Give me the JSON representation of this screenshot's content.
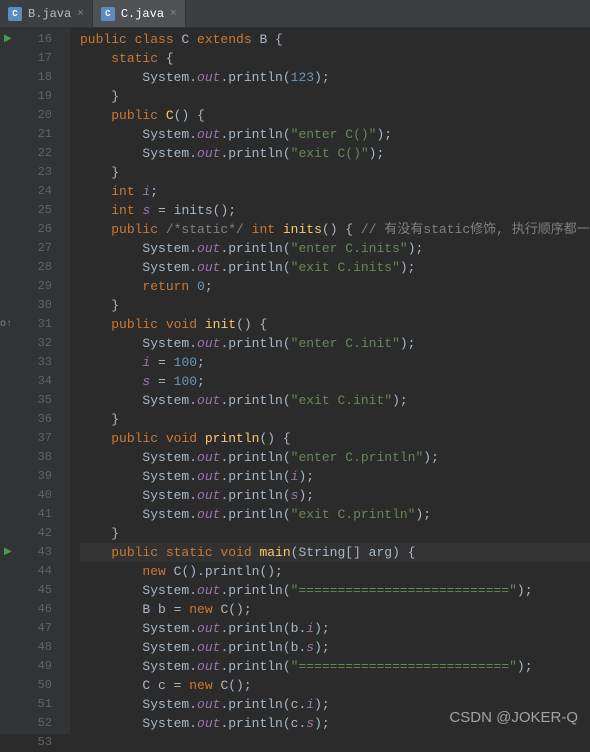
{
  "tabs": [
    {
      "label": "B.java",
      "active": false
    },
    {
      "label": "C.java",
      "active": true
    }
  ],
  "startLine": 16,
  "currentLine": 43,
  "runMarkers": [
    16,
    43
  ],
  "overrideMarkers": [
    31
  ],
  "code": [
    [
      [
        "kw",
        "public class "
      ],
      [
        "ident",
        "C "
      ],
      [
        "kw",
        "extends "
      ],
      [
        "ident",
        "B {"
      ]
    ],
    [
      [
        "ident",
        "    "
      ],
      [
        "kw",
        "static "
      ],
      [
        "ident",
        "{"
      ]
    ],
    [
      [
        "ident",
        "        System."
      ],
      [
        "field",
        "out"
      ],
      [
        "ident",
        ".println("
      ],
      [
        "num",
        "123"
      ],
      [
        "ident",
        ");"
      ]
    ],
    [
      [
        "ident",
        "    }"
      ]
    ],
    [
      [
        "ident",
        "    "
      ],
      [
        "kw",
        "public "
      ],
      [
        "method",
        "C"
      ],
      [
        "ident",
        "() {"
      ]
    ],
    [
      [
        "ident",
        "        System."
      ],
      [
        "field",
        "out"
      ],
      [
        "ident",
        ".println("
      ],
      [
        "str",
        "\"enter C()\""
      ],
      [
        "ident",
        ");"
      ]
    ],
    [
      [
        "ident",
        "        System."
      ],
      [
        "field",
        "out"
      ],
      [
        "ident",
        ".println("
      ],
      [
        "str",
        "\"exit C()\""
      ],
      [
        "ident",
        ");"
      ]
    ],
    [
      [
        "ident",
        "    }"
      ]
    ],
    [
      [
        "ident",
        "    "
      ],
      [
        "kw",
        "int "
      ],
      [
        "field",
        "i"
      ],
      [
        "ident",
        ";"
      ]
    ],
    [
      [
        "ident",
        "    "
      ],
      [
        "kw",
        "int "
      ],
      [
        "field",
        "s"
      ],
      [
        "ident",
        " = inits();"
      ]
    ],
    [
      [
        "ident",
        "    "
      ],
      [
        "kw",
        "public "
      ],
      [
        "comment",
        "/*static*/ "
      ],
      [
        "kw",
        "int "
      ],
      [
        "method",
        "inits"
      ],
      [
        "ident",
        "() { "
      ],
      [
        "comment",
        "// 有没有static修饰, 执行顺序都一样"
      ]
    ],
    [
      [
        "ident",
        "        System."
      ],
      [
        "field",
        "out"
      ],
      [
        "ident",
        ".println("
      ],
      [
        "str",
        "\"enter C.inits\""
      ],
      [
        "ident",
        ");"
      ]
    ],
    [
      [
        "ident",
        "        System."
      ],
      [
        "field",
        "out"
      ],
      [
        "ident",
        ".println("
      ],
      [
        "str",
        "\"exit C.inits\""
      ],
      [
        "ident",
        ");"
      ]
    ],
    [
      [
        "ident",
        "        "
      ],
      [
        "kw",
        "return "
      ],
      [
        "num",
        "0"
      ],
      [
        "ident",
        ";"
      ]
    ],
    [
      [
        "ident",
        "    }"
      ]
    ],
    [
      [
        "ident",
        "    "
      ],
      [
        "kw",
        "public void "
      ],
      [
        "method",
        "init"
      ],
      [
        "ident",
        "() {"
      ]
    ],
    [
      [
        "ident",
        "        System."
      ],
      [
        "field",
        "out"
      ],
      [
        "ident",
        ".println("
      ],
      [
        "str",
        "\"enter C.init\""
      ],
      [
        "ident",
        ");"
      ]
    ],
    [
      [
        "ident",
        "        "
      ],
      [
        "field",
        "i"
      ],
      [
        "ident",
        " = "
      ],
      [
        "num",
        "100"
      ],
      [
        "ident",
        ";"
      ]
    ],
    [
      [
        "ident",
        "        "
      ],
      [
        "field",
        "s"
      ],
      [
        "ident",
        " = "
      ],
      [
        "num",
        "100"
      ],
      [
        "ident",
        ";"
      ]
    ],
    [
      [
        "ident",
        "        System."
      ],
      [
        "field",
        "out"
      ],
      [
        "ident",
        ".println("
      ],
      [
        "str",
        "\"exit C.init\""
      ],
      [
        "ident",
        ");"
      ]
    ],
    [
      [
        "ident",
        "    }"
      ]
    ],
    [
      [
        "ident",
        "    "
      ],
      [
        "kw",
        "public void "
      ],
      [
        "method",
        "println"
      ],
      [
        "ident",
        "() {"
      ]
    ],
    [
      [
        "ident",
        "        System."
      ],
      [
        "field",
        "out"
      ],
      [
        "ident",
        ".println("
      ],
      [
        "str",
        "\"enter C.println\""
      ],
      [
        "ident",
        ");"
      ]
    ],
    [
      [
        "ident",
        "        System."
      ],
      [
        "field",
        "out"
      ],
      [
        "ident",
        ".println("
      ],
      [
        "field",
        "i"
      ],
      [
        "ident",
        ");"
      ]
    ],
    [
      [
        "ident",
        "        System."
      ],
      [
        "field",
        "out"
      ],
      [
        "ident",
        ".println("
      ],
      [
        "field",
        "s"
      ],
      [
        "ident",
        ");"
      ]
    ],
    [
      [
        "ident",
        "        System."
      ],
      [
        "field",
        "out"
      ],
      [
        "ident",
        ".println("
      ],
      [
        "str",
        "\"exit C.println\""
      ],
      [
        "ident",
        ");"
      ]
    ],
    [
      [
        "ident",
        "    }"
      ]
    ],
    [
      [
        "ident",
        "    "
      ],
      [
        "kw",
        "public static void "
      ],
      [
        "method",
        "main"
      ],
      [
        "ident",
        "(String[] arg) {"
      ]
    ],
    [
      [
        "ident",
        "        "
      ],
      [
        "kw",
        "new "
      ],
      [
        "ident",
        "C().println();"
      ]
    ],
    [
      [
        "ident",
        "        System."
      ],
      [
        "field",
        "out"
      ],
      [
        "ident",
        ".println("
      ],
      [
        "str",
        "\"===========================\""
      ],
      [
        "ident",
        ");"
      ]
    ],
    [
      [
        "ident",
        "        B b = "
      ],
      [
        "kw",
        "new "
      ],
      [
        "ident",
        "C();"
      ]
    ],
    [
      [
        "ident",
        "        System."
      ],
      [
        "field",
        "out"
      ],
      [
        "ident",
        ".println(b."
      ],
      [
        "field",
        "i"
      ],
      [
        "ident",
        ");"
      ]
    ],
    [
      [
        "ident",
        "        System."
      ],
      [
        "field",
        "out"
      ],
      [
        "ident",
        ".println(b."
      ],
      [
        "field",
        "s"
      ],
      [
        "ident",
        ");"
      ]
    ],
    [
      [
        "ident",
        "        System."
      ],
      [
        "field",
        "out"
      ],
      [
        "ident",
        ".println("
      ],
      [
        "str",
        "\"===========================\""
      ],
      [
        "ident",
        ");"
      ]
    ],
    [
      [
        "ident",
        "        C c = "
      ],
      [
        "kw",
        "new "
      ],
      [
        "ident",
        "C();"
      ]
    ],
    [
      [
        "ident",
        "        System."
      ],
      [
        "field",
        "out"
      ],
      [
        "ident",
        ".println(c."
      ],
      [
        "field",
        "i"
      ],
      [
        "ident",
        ");"
      ]
    ],
    [
      [
        "ident",
        "        System."
      ],
      [
        "field",
        "out"
      ],
      [
        "ident",
        ".println(c."
      ],
      [
        "field",
        "s"
      ],
      [
        "ident",
        ");"
      ]
    ],
    [
      [
        "ident",
        "    }"
      ]
    ]
  ],
  "watermark": "CSDN @JOKER-Q"
}
